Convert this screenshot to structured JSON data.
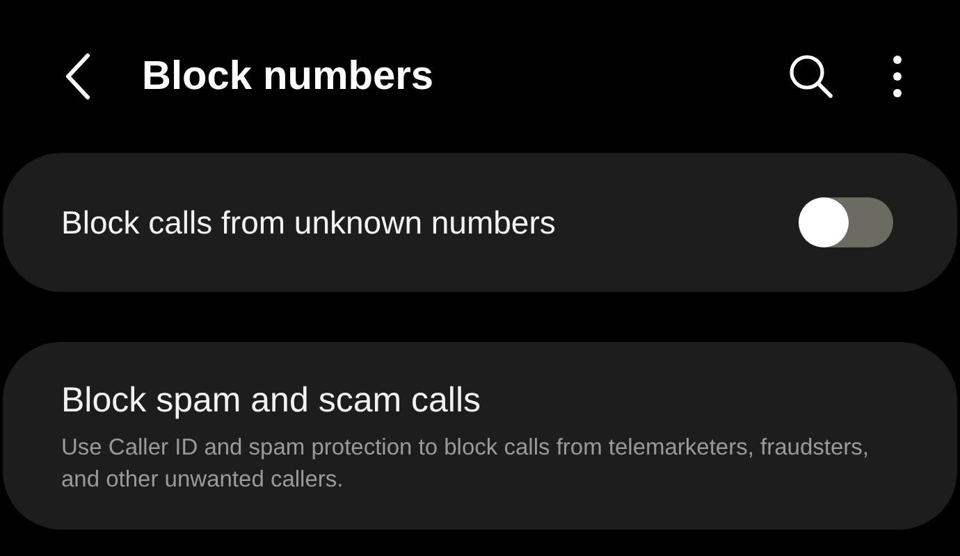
{
  "header": {
    "title": "Block numbers"
  },
  "settings": [
    {
      "kind": "toggle",
      "label": "Block calls from unknown numbers",
      "on": false
    },
    {
      "kind": "link",
      "label": "Block spam and scam calls",
      "description": "Use Caller ID and spam protection to block calls from telemarketers, fraudsters, and other unwanted callers."
    }
  ]
}
